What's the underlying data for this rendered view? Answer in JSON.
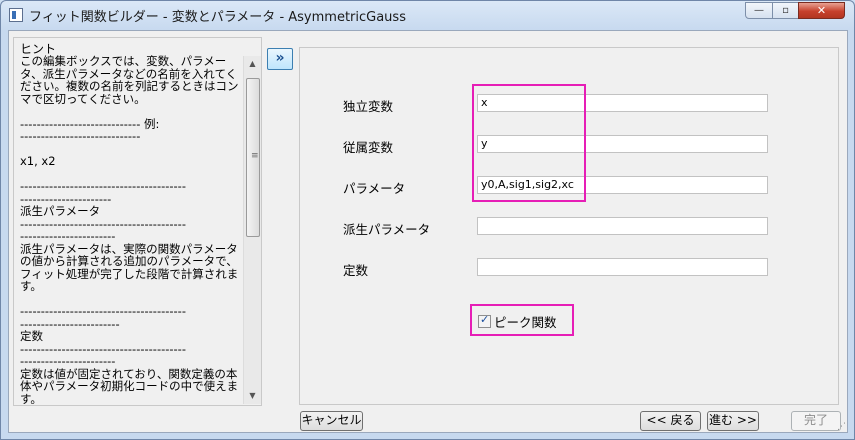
{
  "window": {
    "title": "フィット関数ビルダー - 変数とパラメータ - AsymmetricGauss",
    "minimize": "—",
    "maximize": "▫",
    "close": "✕"
  },
  "hint": {
    "label": "ヒント",
    "text": "この編集ボックスでは、変数、パラメータ、派生パラメータなどの名前を入れてください。複数の名前を列記するときはコンマで区切ってください。\n\n----------------------------- 例:\n-----------------------------\n\nx1, x2\n\n----------------------------------------\n----------------------\n派生パラメータ\n----------------------------------------\n-----------------------\n派生パラメータは、実際の関数パラメータの値から計算される追加のパラメータで、フィット処理が完了した段階で計算されます。\n\n----------------------------------------\n------------------------\n定数\n----------------------------------------\n-----------------------\n定数は値が固定されており、関数定義の本体やパラメータ初期化コードの中で使えます。\n\n----------------------------------------"
  },
  "collapse_button": "»",
  "form": {
    "independent_label": "独立変数",
    "independent_value": "x",
    "dependent_label": "従属変数",
    "dependent_value": "y",
    "params_label": "パラメータ",
    "params_value": "y0,A,sig1,sig2,xc",
    "derived_label": "派生パラメータ",
    "derived_value": "",
    "constants_label": "定数",
    "constants_value": "",
    "peak_label": "ピーク関数",
    "peak_checked": true
  },
  "buttons": {
    "cancel": "キャンセル",
    "back": "<< 戻る",
    "next": "進む >>",
    "finish": "完了"
  },
  "colors": {
    "highlight": "#e61eb6",
    "title_bar": "#c7d9ef",
    "close_button": "#c7412d"
  }
}
